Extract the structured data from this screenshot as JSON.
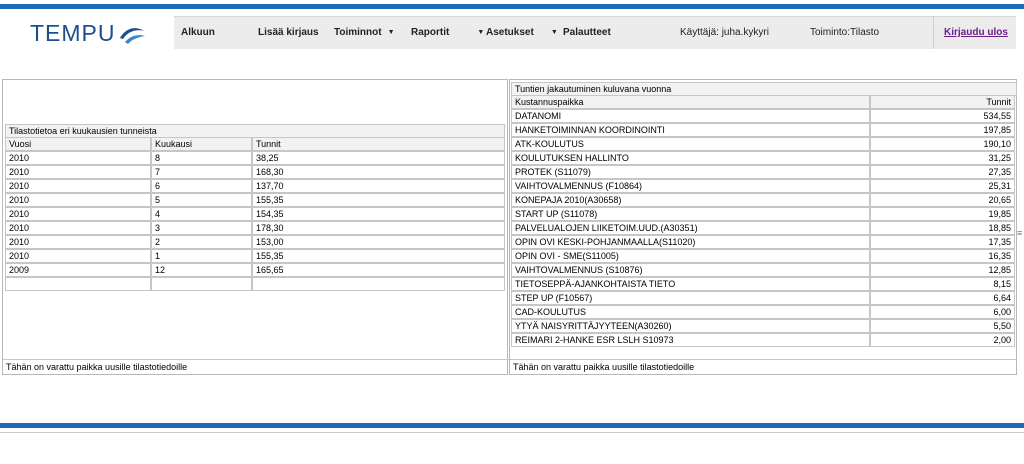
{
  "app": {
    "logo_text": "TEMPU"
  },
  "nav": {
    "items": [
      {
        "label": "Alkuun",
        "dropdown": false
      },
      {
        "label": "Lisää kirjaus",
        "dropdown": false
      },
      {
        "label": "Toiminnot",
        "dropdown": true
      },
      {
        "label": "Raportit",
        "dropdown": true
      },
      {
        "label": "Asetukset",
        "dropdown": true
      },
      {
        "label": "Palautteet",
        "dropdown": false
      }
    ],
    "user": "Käyttäjä: juha.kykyri",
    "activity": "Toiminto:Tilasto",
    "logout": "Kirjaudu ulos"
  },
  "monthly": {
    "title": "Tilastotietoa eri kuukausien tunneista",
    "headers": [
      "Vuosi",
      "Kuukausi",
      "Tunnit"
    ],
    "rows": [
      [
        "2010",
        "8",
        "38,25"
      ],
      [
        "2010",
        "7",
        "168,30"
      ],
      [
        "2010",
        "6",
        "137,70"
      ],
      [
        "2010",
        "5",
        "155,35"
      ],
      [
        "2010",
        "4",
        "154,35"
      ],
      [
        "2010",
        "3",
        "178,30"
      ],
      [
        "2010",
        "2",
        "153,00"
      ],
      [
        "2010",
        "1",
        "155,35"
      ],
      [
        "2009",
        "12",
        "165,65"
      ]
    ],
    "footer": "Tähän on varattu paikka uusille tilastotiedoille"
  },
  "distribution": {
    "title": "Tuntien jakautuminen kuluvana vuonna",
    "headers": [
      "Kustannuspaikka",
      "Tunnit"
    ],
    "rows": [
      [
        "DATANOMI",
        "534,55"
      ],
      [
        "HANKETOIMINNAN KOORDINOINTI",
        "197,85"
      ],
      [
        "ATK-KOULUTUS",
        "190,10"
      ],
      [
        "KOULUTUKSEN HALLINTO",
        "31,25"
      ],
      [
        "PROTEK (S11079)",
        "27,35"
      ],
      [
        "VAIHTOVALMENNUS (F10864)",
        "25,31"
      ],
      [
        "KONEPAJA 2010(A30658)",
        "20,65"
      ],
      [
        "START UP (S11078)",
        "19,85"
      ],
      [
        "PALVELUALOJEN LIIKETOIM.UUD.(A30351)",
        "18,85"
      ],
      [
        "OPIN OVI KESKI-POHJANMAALLA(S11020)",
        "17,35"
      ],
      [
        "OPIN OVI - SME(S11005)",
        "16,35"
      ],
      [
        "VAIHTOVALMENNUS (S10876)",
        "12,85"
      ],
      [
        "TIETOSEPPÄ-AJANKOHTAISTA TIETO",
        "8,15"
      ],
      [
        "STEP UP (F10567)",
        "6,64"
      ],
      [
        "CAD-KOULUTUS",
        "6,00"
      ],
      [
        "YTYÄ NAISYRITTÄJYYTEEN(A30260)",
        "5,50"
      ],
      [
        "REIMARI 2-HANKE ESR LSLH S10973",
        "2,00"
      ]
    ],
    "footer": "Tähän on varattu paikka uusille tilastotiedoille"
  },
  "colors": {
    "brand_bar": "#1e6bb8",
    "logo": "#1f4e8c",
    "logout_link": "#6a1e8a"
  }
}
